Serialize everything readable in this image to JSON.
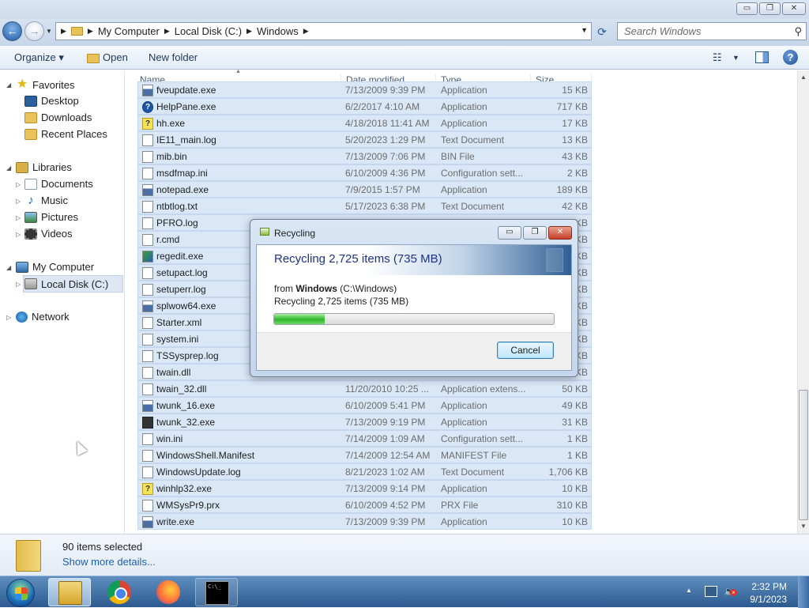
{
  "window": {
    "controls": {
      "minimize": "▭",
      "maximize": "❐",
      "close": "✕"
    }
  },
  "address": {
    "crumbs": [
      "My Computer",
      "Local Disk (C:)",
      "Windows"
    ],
    "search_placeholder": "Search Windows"
  },
  "toolbar": {
    "organize": "Organize ▾",
    "open": "Open",
    "new_folder": "New folder"
  },
  "navigation": {
    "favorites": {
      "label": "Favorites",
      "items": [
        "Desktop",
        "Downloads",
        "Recent Places"
      ]
    },
    "libraries": {
      "label": "Libraries",
      "items": [
        "Documents",
        "Music",
        "Pictures",
        "Videos"
      ]
    },
    "computer": {
      "label": "My Computer",
      "items": [
        "Local Disk (C:)"
      ]
    },
    "network": {
      "label": "Network"
    }
  },
  "columns": {
    "name": "Name",
    "date": "Date modified",
    "type": "Type",
    "size": "Size"
  },
  "files": [
    {
      "name": "fveupdate.exe",
      "date": "7/13/2009 9:39 PM",
      "type": "Application",
      "size": "15 KB",
      "icon": "exe"
    },
    {
      "name": "HelpPane.exe",
      "date": "6/2/2017 4:10 AM",
      "type": "Application",
      "size": "717 KB",
      "icon": "help"
    },
    {
      "name": "hh.exe",
      "date": "4/18/2018 11:41 AM",
      "type": "Application",
      "size": "17 KB",
      "icon": "hh"
    },
    {
      "name": "IE11_main.log",
      "date": "5/20/2023 1:29 PM",
      "type": "Text Document",
      "size": "13 KB",
      "icon": "blank"
    },
    {
      "name": "mib.bin",
      "date": "7/13/2009 7:06 PM",
      "type": "BIN File",
      "size": "43 KB",
      "icon": "blank"
    },
    {
      "name": "msdfmap.ini",
      "date": "6/10/2009 4:36 PM",
      "type": "Configuration sett...",
      "size": "2 KB",
      "icon": "blank"
    },
    {
      "name": "notepad.exe",
      "date": "7/9/2015 1:57 PM",
      "type": "Application",
      "size": "189 KB",
      "icon": "exe"
    },
    {
      "name": "ntbtlog.txt",
      "date": "5/17/2023 6:38 PM",
      "type": "Text Document",
      "size": "42 KB",
      "icon": "blank"
    },
    {
      "name": "PFRO.log",
      "date": "",
      "type": "",
      "size": "KB",
      "icon": "blank"
    },
    {
      "name": "r.cmd",
      "date": "",
      "type": "",
      "size": "KB",
      "icon": "blank"
    },
    {
      "name": "regedit.exe",
      "date": "",
      "type": "",
      "size": "KB",
      "icon": "reg"
    },
    {
      "name": "setupact.log",
      "date": "",
      "type": "",
      "size": "KB",
      "icon": "blank"
    },
    {
      "name": "setuperr.log",
      "date": "",
      "type": "",
      "size": "KB",
      "icon": "blank"
    },
    {
      "name": "splwow64.exe",
      "date": "",
      "type": "",
      "size": "KB",
      "icon": "exe"
    },
    {
      "name": "Starter.xml",
      "date": "",
      "type": "",
      "size": "KB",
      "icon": "blank"
    },
    {
      "name": "system.ini",
      "date": "",
      "type": "",
      "size": "KB",
      "icon": "blank"
    },
    {
      "name": "TSSysprep.log",
      "date": "",
      "type": "",
      "size": "KB",
      "icon": "blank"
    },
    {
      "name": "twain.dll",
      "date": "",
      "type": "",
      "size": "KB",
      "icon": "blank"
    },
    {
      "name": "twain_32.dll",
      "date": "11/20/2010 10:25 ...",
      "type": "Application extens...",
      "size": "50 KB",
      "icon": "blank"
    },
    {
      "name": "twunk_16.exe",
      "date": "6/10/2009 5:41 PM",
      "type": "Application",
      "size": "49 KB",
      "icon": "exe"
    },
    {
      "name": "twunk_32.exe",
      "date": "7/13/2009 9:19 PM",
      "type": "Application",
      "size": "31 KB",
      "icon": "win"
    },
    {
      "name": "win.ini",
      "date": "7/14/2009 1:09 AM",
      "type": "Configuration sett...",
      "size": "1 KB",
      "icon": "blank"
    },
    {
      "name": "WindowsShell.Manifest",
      "date": "7/14/2009 12:54 AM",
      "type": "MANIFEST File",
      "size": "1 KB",
      "icon": "blank"
    },
    {
      "name": "WindowsUpdate.log",
      "date": "8/21/2023 1:02 AM",
      "type": "Text Document",
      "size": "1,706 KB",
      "icon": "blank"
    },
    {
      "name": "winhlp32.exe",
      "date": "7/13/2009 9:14 PM",
      "type": "Application",
      "size": "10 KB",
      "icon": "hh"
    },
    {
      "name": "WMSysPr9.prx",
      "date": "6/10/2009 4:52 PM",
      "type": "PRX File",
      "size": "310 KB",
      "icon": "blank"
    },
    {
      "name": "write.exe",
      "date": "7/13/2009 9:39 PM",
      "type": "Application",
      "size": "10 KB",
      "icon": "exe"
    }
  ],
  "details": {
    "count": "90 items selected",
    "more": "Show more details..."
  },
  "dialog": {
    "title": "Recycling",
    "header": "Recycling 2,725 items (735 MB)",
    "from_prefix": "from ",
    "from_name": "Windows",
    "from_path": " (C:\\Windows)",
    "status": "Recycling 2,725 items (735 MB)",
    "progress": 0.18,
    "cancel": "Cancel"
  },
  "tray": {
    "time": "2:32 PM",
    "date": "9/1/2023"
  },
  "taskbar": {
    "cmd_icon_text": "C:\\_"
  }
}
